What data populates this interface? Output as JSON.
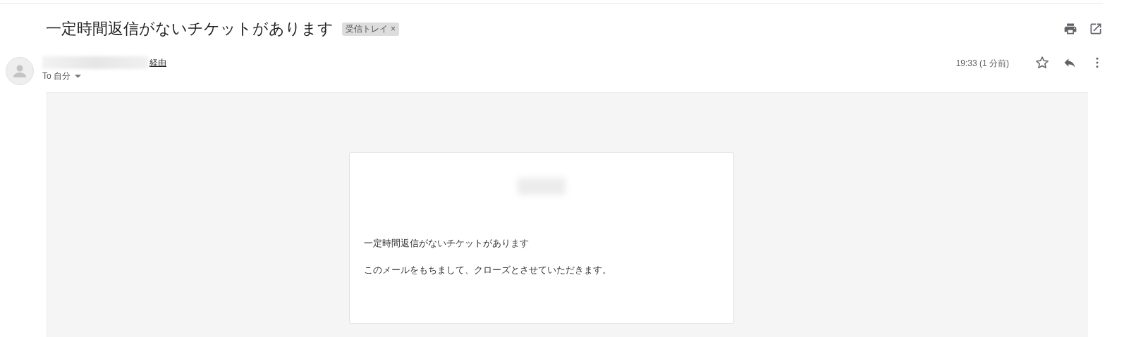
{
  "subject": "一定時間返信がないチケットがあります",
  "labels": [
    {
      "text": "受信トレイ",
      "remove": "×"
    }
  ],
  "sender": {
    "via": "経由",
    "recipient": "To 自分"
  },
  "time": "19:33 (1 分前)",
  "starred": false,
  "body": {
    "paragraphs": [
      "一定時間返信がないチケットがあります",
      "このメールをもちまして、クローズとさせていただきます。"
    ]
  }
}
